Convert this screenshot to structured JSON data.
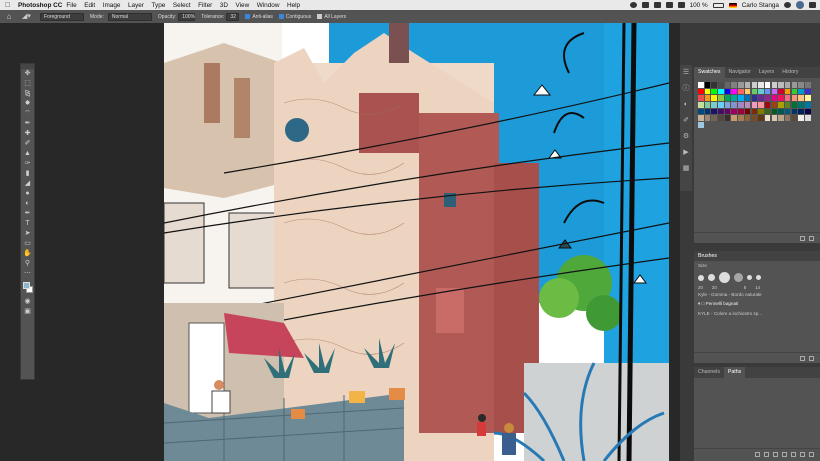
{
  "menubar": {
    "app": "Photoshop CC",
    "items": [
      "File",
      "Edit",
      "Image",
      "Layer",
      "Type",
      "Select",
      "Filter",
      "3D",
      "View",
      "Window",
      "Help"
    ],
    "battery": "100 %",
    "user": "Carlo Stanga"
  },
  "options": {
    "fill_source": "Foreground",
    "mode_label": "Mode:",
    "mode_value": "Normal",
    "opacity_label": "Opacity:",
    "opacity_value": "100%",
    "tolerance_label": "Tolerance:",
    "tolerance_value": "32",
    "antialias": "Anti-alias",
    "contiguous": "Contiguous",
    "all_layers": "All Layers"
  },
  "panels": {
    "top_tabs": [
      "Swatches",
      "Navigator",
      "Layers",
      "History"
    ],
    "brushes_title": "Brushes",
    "brush_size_label": "Size",
    "brush_sizes": [
      "20",
      "20",
      "8",
      "14"
    ],
    "brush_item": "Kyle - Gomma - Bordo naturale",
    "brush_folder": "Pennelli bagnati",
    "brush_item2": "KYLE - Colore a inchiostro sp...",
    "bottom_tabs": [
      "Channels",
      "Paths"
    ]
  },
  "swatch_colors": [
    "#ffffff",
    "#000000",
    "#333333",
    "#4d4d4d",
    "#666666",
    "#808080",
    "#999999",
    "#b3b3b3",
    "#cccccc",
    "#e6e6e6",
    "#ffffff",
    "#cccccc",
    "#bbbbbb",
    "#aaaaaa",
    "#999999",
    "#888888",
    "#777777",
    "#ff0000",
    "#ffff00",
    "#00ff00",
    "#00ffff",
    "#0000ff",
    "#ff00ff",
    "#ff6666",
    "#ffcc66",
    "#66cc66",
    "#66cccc",
    "#6699ff",
    "#cc66ff",
    "#cc0033",
    "#ff9900",
    "#33cc33",
    "#0099cc",
    "#3333cc",
    "#f04e4e",
    "#f7941d",
    "#fff200",
    "#8dc63f",
    "#00a651",
    "#00a99d",
    "#00aeef",
    "#0072bc",
    "#2e3192",
    "#662d91",
    "#92278f",
    "#ec008c",
    "#ed145b",
    "#f26d7d",
    "#f69679",
    "#fdc689",
    "#fff799",
    "#c4df9b",
    "#82ca9c",
    "#7accc8",
    "#6dcff6",
    "#7da7d9",
    "#8493ca",
    "#a187be",
    "#bd8cbf",
    "#f49ac1",
    "#f5989d",
    "#9e0b0f",
    "#a0410d",
    "#aba000",
    "#598527",
    "#007236",
    "#00746b",
    "#0076a3",
    "#004a80",
    "#003471",
    "#1b1464",
    "#440e62",
    "#630460",
    "#9e005d",
    "#9e0039",
    "#790000",
    "#7b2e00",
    "#827b00",
    "#406618",
    "#005e20",
    "#005952",
    "#005b7f",
    "#003663",
    "#002157",
    "#0d004c",
    "#c7b299",
    "#998675",
    "#736357",
    "#534741",
    "#37302d",
    "#c69c6d",
    "#a67c52",
    "#8c6239",
    "#754c24",
    "#603913",
    "#ede1d0",
    "#d9c9b0",
    "#b7a48a",
    "#8a7762",
    "#5c4a3a",
    "#eeeeee",
    "#dddddd",
    "#9fc8e0"
  ]
}
